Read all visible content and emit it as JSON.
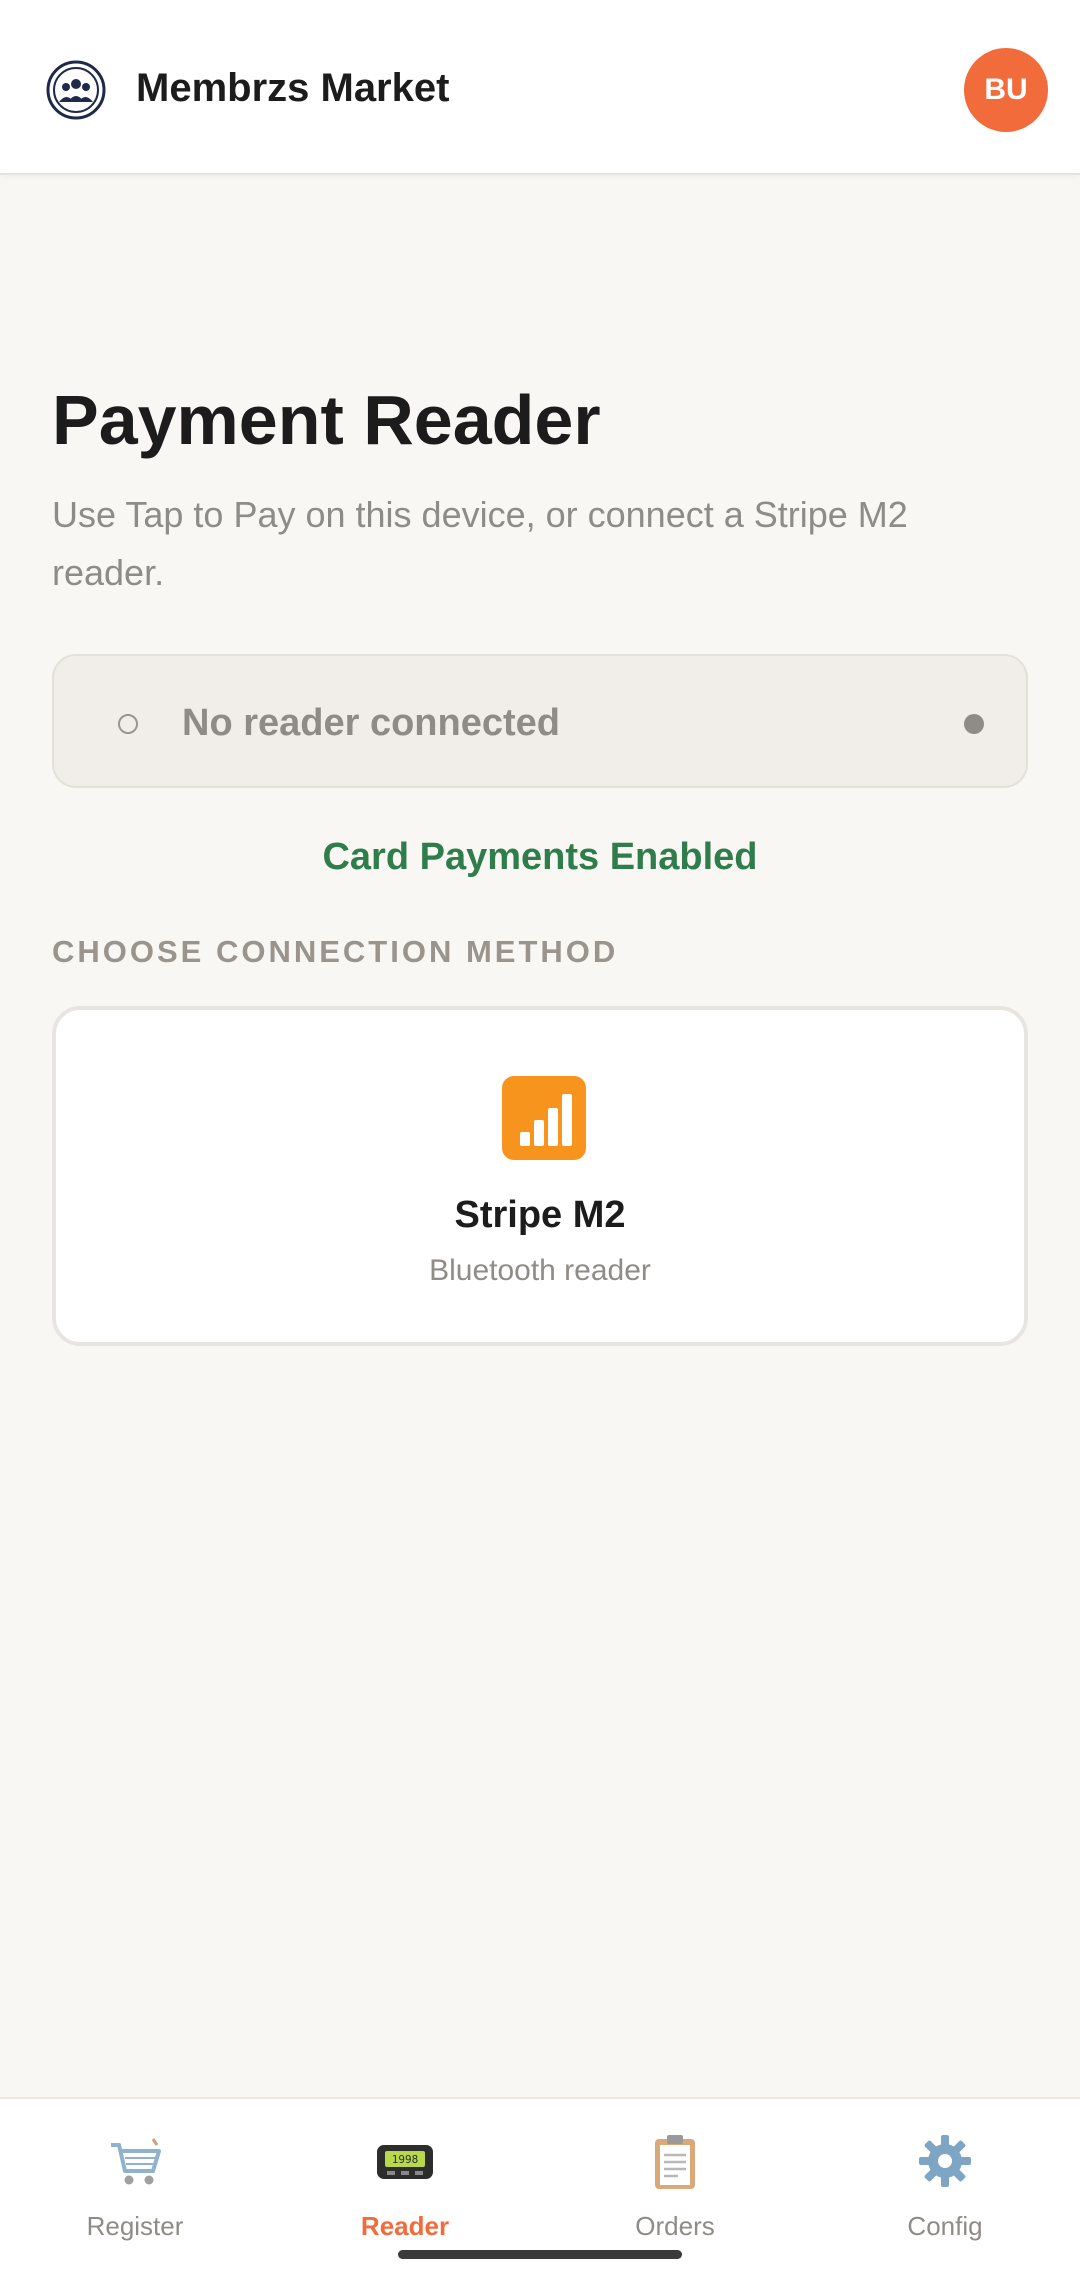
{
  "header": {
    "app_title": "Membrzs Market",
    "logo_icon": "community-logo-icon",
    "avatar_initials": "BU"
  },
  "main": {
    "title": "Payment Reader",
    "subtitle": "Use Tap to Pay on this device, or connect a Stripe M2 reader.",
    "status": {
      "text": "No reader connected"
    },
    "card_payments_status": "Card Payments Enabled",
    "section_label": "CHOOSE CONNECTION METHOD",
    "methods": [
      {
        "icon": "signal-bars-icon",
        "title": "Stripe M2",
        "subtitle": "Bluetooth reader"
      }
    ]
  },
  "bottom_nav": {
    "items": [
      {
        "label": "Register",
        "icon": "cart-icon",
        "active": false
      },
      {
        "label": "Reader",
        "icon": "card-reader-icon",
        "active": true
      },
      {
        "label": "Orders",
        "icon": "clipboard-icon",
        "active": false
      },
      {
        "label": "Config",
        "icon": "gear-icon",
        "active": false
      }
    ]
  },
  "colors": {
    "accent": "#f26b3a",
    "success": "#2e7d4a",
    "background": "#f8f7f4"
  }
}
